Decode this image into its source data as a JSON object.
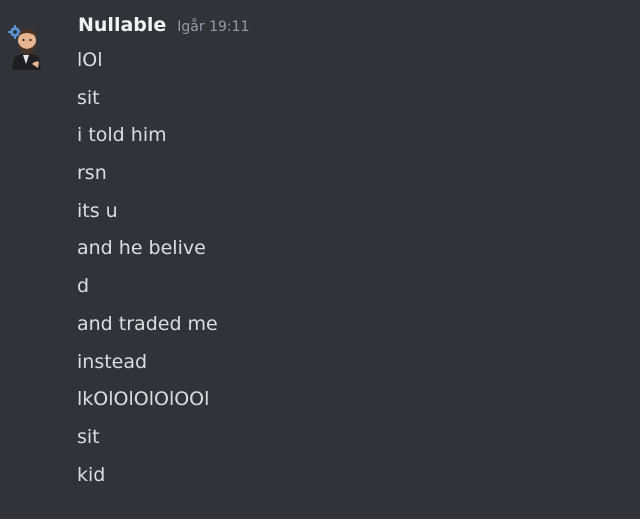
{
  "message": {
    "author": "Nullable",
    "timestamp": "Igår 19:11",
    "lines": [
      "lOl",
      "sit",
      "i told him",
      "rsn",
      "its u",
      "and he belive",
      "d",
      "and traded me",
      "instead",
      "lkOlOlOlOlOOl",
      "sit",
      "kid"
    ]
  },
  "icons": {
    "avatar": "bearded-man-avatar-icon",
    "avatar_badge": "gear-badge-icon"
  },
  "colors": {
    "background": "#313338",
    "username": "#f2f3f5",
    "text": "#dbdee1",
    "timestamp": "#949ba4"
  }
}
